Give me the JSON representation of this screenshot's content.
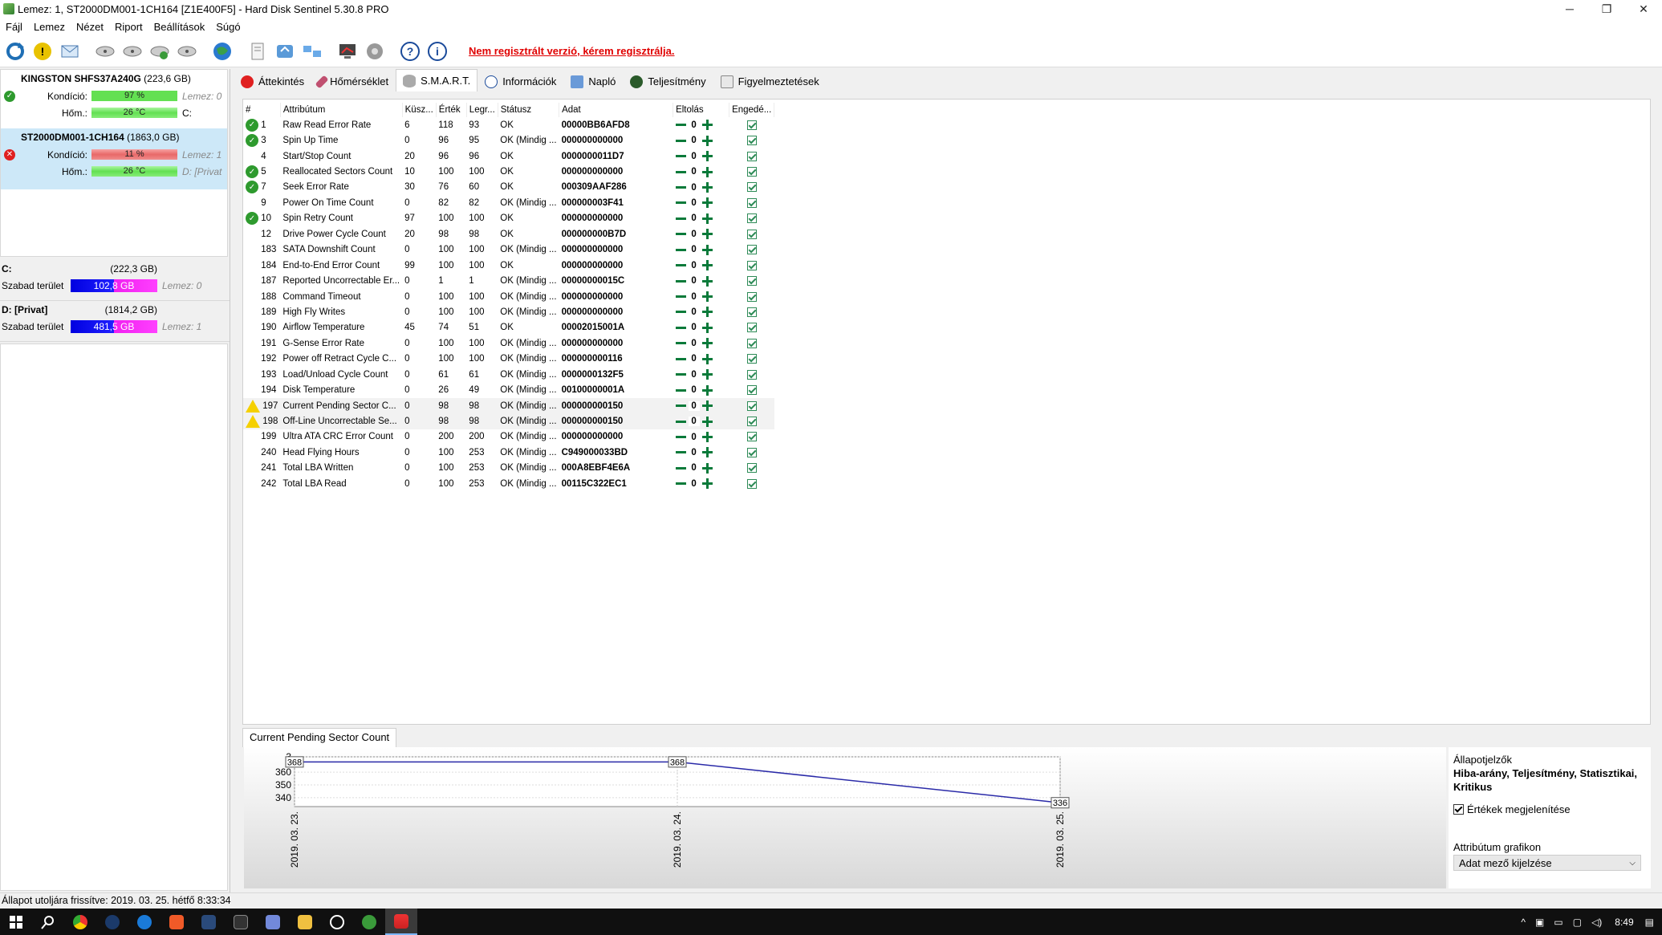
{
  "window": {
    "title": "Lemez: 1, ST2000DM001-1CH164 [Z1E400F5]  -  Hard Disk Sentinel 5.30.8 PRO",
    "controls": [
      "─",
      "❐",
      "✕"
    ]
  },
  "menu": [
    "Fájl",
    "Lemez",
    "Nézet",
    "Riport",
    "Beállítások",
    "Súgó"
  ],
  "toolbar": {
    "icons": [
      "refresh-icon",
      "warning-icon",
      "email-icon",
      "disk-test-icon",
      "disk-test2-icon",
      "disk-test3-icon",
      "disk-test4-icon",
      "globe-icon",
      "report-icon",
      "sync-icon",
      "network-icon",
      "monitor-icon",
      "settings-icon",
      "help-icon",
      "info-icon"
    ],
    "register_link": "Nem regisztrált verzió, kérem regisztrálja."
  },
  "disks": [
    {
      "name": "KINGSTON SHFS37A240G",
      "size": "(223,6 GB)",
      "condition_label": "Kondíció:",
      "condition_value": "97 %",
      "condition_fill": 0.97,
      "condition_extra": "Lemez: 0",
      "temp_label": "Hőm.:",
      "temp_value": "26 °C",
      "temp_extra": "C:"
    },
    {
      "name": "ST2000DM001-1CH164",
      "size": "(1863,0 GB)",
      "condition_label": "Kondíció:",
      "condition_value": "11 %",
      "condition_fill": 0.11,
      "condition_extra": "Lemez: 1",
      "temp_label": "Hőm.:",
      "temp_value": "26 °C",
      "temp_extra": "D: [Privat"
    }
  ],
  "volumes": [
    {
      "name": "C:",
      "size": "(222,3 GB)",
      "free_label": "Szabad terület",
      "free_value": "102,8 GB",
      "disk": "Lemez: 0"
    },
    {
      "name": "D: [Privat]",
      "size": "(1814,2 GB)",
      "free_label": "Szabad terület",
      "free_value": "481,5 GB",
      "disk": "Lemez: 1"
    }
  ],
  "tabs": [
    "Áttekintés",
    "Hőmérséklet",
    "S.M.A.R.T.",
    "Információk",
    "Napló",
    "Teljesítmény",
    "Figyelmeztetések"
  ],
  "smart": {
    "headers": [
      "#",
      "Attribútum",
      "Küsz...",
      "Érték",
      "Legr...",
      "Státusz",
      "Adat",
      "Eltolás",
      "Engedé..."
    ],
    "rows": [
      {
        "icon": "ok",
        "id": "1",
        "name": "Raw Read Error Rate",
        "thr": "6",
        "val": "118",
        "worst": "93",
        "status": "OK",
        "data": "00000BB6AFD8",
        "offset": "0"
      },
      {
        "icon": "ok",
        "id": "3",
        "name": "Spin Up Time",
        "thr": "0",
        "val": "96",
        "worst": "95",
        "status": "OK (Mindig ...",
        "data": "000000000000",
        "offset": "0"
      },
      {
        "icon": "",
        "id": "4",
        "name": "Start/Stop Count",
        "thr": "20",
        "val": "96",
        "worst": "96",
        "status": "OK",
        "data": "0000000011D7",
        "offset": "0"
      },
      {
        "icon": "ok",
        "id": "5",
        "name": "Reallocated Sectors Count",
        "thr": "10",
        "val": "100",
        "worst": "100",
        "status": "OK",
        "data": "000000000000",
        "offset": "0"
      },
      {
        "icon": "ok",
        "id": "7",
        "name": "Seek Error Rate",
        "thr": "30",
        "val": "76",
        "worst": "60",
        "status": "OK",
        "data": "000309AAF286",
        "offset": "0"
      },
      {
        "icon": "",
        "id": "9",
        "name": "Power On Time Count",
        "thr": "0",
        "val": "82",
        "worst": "82",
        "status": "OK (Mindig ...",
        "data": "000000003F41",
        "offset": "0"
      },
      {
        "icon": "ok",
        "id": "10",
        "name": "Spin Retry Count",
        "thr": "97",
        "val": "100",
        "worst": "100",
        "status": "OK",
        "data": "000000000000",
        "offset": "0"
      },
      {
        "icon": "",
        "id": "12",
        "name": "Drive Power Cycle Count",
        "thr": "20",
        "val": "98",
        "worst": "98",
        "status": "OK",
        "data": "000000000B7D",
        "offset": "0"
      },
      {
        "icon": "",
        "id": "183",
        "name": "SATA Downshift Count",
        "thr": "0",
        "val": "100",
        "worst": "100",
        "status": "OK (Mindig ...",
        "data": "000000000000",
        "offset": "0"
      },
      {
        "icon": "",
        "id": "184",
        "name": "End-to-End Error Count",
        "thr": "99",
        "val": "100",
        "worst": "100",
        "status": "OK",
        "data": "000000000000",
        "offset": "0"
      },
      {
        "icon": "",
        "id": "187",
        "name": "Reported Uncorrectable Er...",
        "thr": "0",
        "val": "1",
        "worst": "1",
        "status": "OK (Mindig ...",
        "data": "00000000015C",
        "offset": "0"
      },
      {
        "icon": "",
        "id": "188",
        "name": "Command Timeout",
        "thr": "0",
        "val": "100",
        "worst": "100",
        "status": "OK (Mindig ...",
        "data": "000000000000",
        "offset": "0"
      },
      {
        "icon": "",
        "id": "189",
        "name": "High Fly Writes",
        "thr": "0",
        "val": "100",
        "worst": "100",
        "status": "OK (Mindig ...",
        "data": "000000000000",
        "offset": "0"
      },
      {
        "icon": "",
        "id": "190",
        "name": "Airflow Temperature",
        "thr": "45",
        "val": "74",
        "worst": "51",
        "status": "OK",
        "data": "00002015001A",
        "offset": "0"
      },
      {
        "icon": "",
        "id": "191",
        "name": "G-Sense Error Rate",
        "thr": "0",
        "val": "100",
        "worst": "100",
        "status": "OK (Mindig ...",
        "data": "000000000000",
        "offset": "0"
      },
      {
        "icon": "",
        "id": "192",
        "name": "Power off Retract Cycle C...",
        "thr": "0",
        "val": "100",
        "worst": "100",
        "status": "OK (Mindig ...",
        "data": "000000000116",
        "offset": "0"
      },
      {
        "icon": "",
        "id": "193",
        "name": "Load/Unload Cycle Count",
        "thr": "0",
        "val": "61",
        "worst": "61",
        "status": "OK (Mindig ...",
        "data": "0000000132F5",
        "offset": "0"
      },
      {
        "icon": "",
        "id": "194",
        "name": "Disk Temperature",
        "thr": "0",
        "val": "26",
        "worst": "49",
        "status": "OK (Mindig ...",
        "data": "00100000001A",
        "offset": "0"
      },
      {
        "icon": "warn",
        "id": "197",
        "name": "Current Pending Sector C...",
        "thr": "0",
        "val": "98",
        "worst": "98",
        "status": "OK (Mindig ...",
        "data": "000000000150",
        "offset": "0"
      },
      {
        "icon": "warn",
        "id": "198",
        "name": "Off-Line Uncorrectable Se...",
        "thr": "0",
        "val": "98",
        "worst": "98",
        "status": "OK (Mindig ...",
        "data": "000000000150",
        "offset": "0"
      },
      {
        "icon": "",
        "id": "199",
        "name": "Ultra ATA CRC Error Count",
        "thr": "0",
        "val": "200",
        "worst": "200",
        "status": "OK (Mindig ...",
        "data": "000000000000",
        "offset": "0"
      },
      {
        "icon": "",
        "id": "240",
        "name": "Head Flying Hours",
        "thr": "0",
        "val": "100",
        "worst": "253",
        "status": "OK (Mindig ...",
        "data": "C949000033BD",
        "offset": "0"
      },
      {
        "icon": "",
        "id": "241",
        "name": "Total LBA Written",
        "thr": "0",
        "val": "100",
        "worst": "253",
        "status": "OK (Mindig ...",
        "data": "000A8EBF4E6A",
        "offset": "0"
      },
      {
        "icon": "",
        "id": "242",
        "name": "Total LBA Read",
        "thr": "0",
        "val": "100",
        "worst": "253",
        "status": "OK (Mindig ...",
        "data": "00115C322EC1",
        "offset": "0"
      }
    ]
  },
  "graph_tab": "Current Pending Sector Count",
  "chart_data": {
    "type": "line",
    "x": [
      "2019. 03. 23.",
      "2019. 03. 24.",
      "2019. 03. 25."
    ],
    "series": [
      {
        "values": [
          368,
          368,
          336
        ]
      }
    ],
    "data_labels": [
      "368",
      "368",
      "336"
    ],
    "yticks": [
      "3",
      "360",
      "350",
      "340"
    ],
    "ylim": [
      333,
      372
    ],
    "color": "#2a2aa8"
  },
  "side_panel": {
    "title": "Állapotjelzők",
    "bold_text": "Hiba-arány, Teljesítmény, Statisztikai, Kritikus",
    "checkbox_label": "Értékek megjelenítése",
    "attr_label": "Attribútum grafikon",
    "dropdown_value": "Adat mező kijelzése"
  },
  "statusbar": "Állapot utoljára frissítve: 2019. 03. 25. hétfő 8:33:34",
  "taskbar": {
    "time": "8:49"
  }
}
